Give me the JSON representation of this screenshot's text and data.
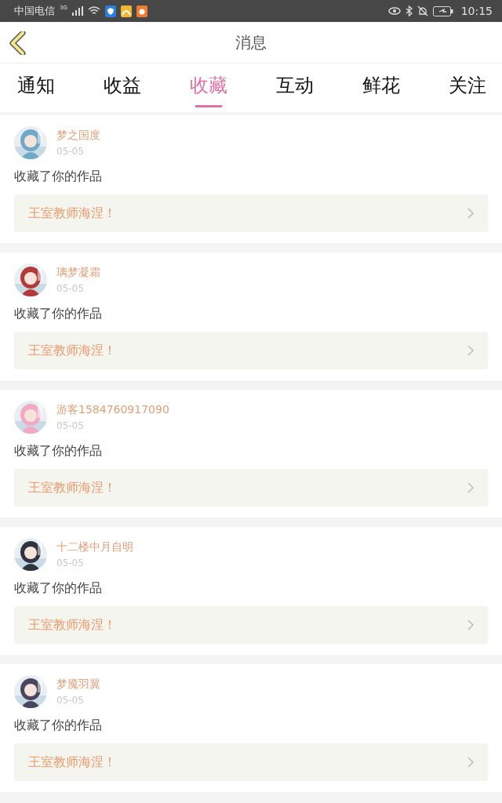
{
  "status_bar": {
    "carrier": "中国电信",
    "network": "3G",
    "time": "10:15"
  },
  "header": {
    "title": "消息"
  },
  "tabs": [
    {
      "label": "通知",
      "selected": false
    },
    {
      "label": "收益",
      "selected": false
    },
    {
      "label": "收藏",
      "selected": true
    },
    {
      "label": "互动",
      "selected": false
    },
    {
      "label": "鲜花",
      "selected": false
    },
    {
      "label": "关注",
      "selected": false
    }
  ],
  "messages": [
    {
      "user": "梦之国度",
      "date": "05-05",
      "text": "收藏了你的作品",
      "work": "王室教师海涅！"
    },
    {
      "user": "璃梦凝霜",
      "date": "05-05",
      "text": "收藏了你的作品",
      "work": "王室教师海涅！"
    },
    {
      "user": "游客1584760917090",
      "date": "05-05",
      "text": "收藏了你的作品",
      "work": "王室教师海涅！"
    },
    {
      "user": "十二楼中月自明",
      "date": "05-05",
      "text": "收藏了你的作品",
      "work": "王室教师海涅！"
    },
    {
      "user": "梦魇羽翼",
      "date": "05-05",
      "text": "收藏了你的作品",
      "work": "王室教师海涅！"
    }
  ]
}
